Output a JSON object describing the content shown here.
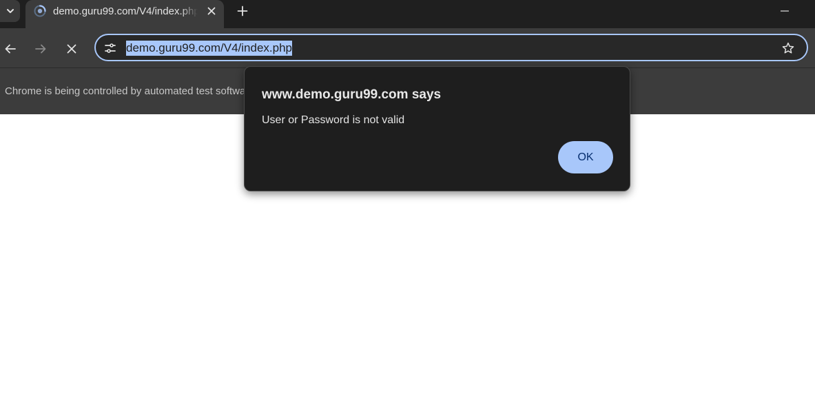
{
  "browser": {
    "tab": {
      "title": "demo.guru99.com/V4/index.php",
      "favicon": "loading-spinner-icon"
    },
    "controls": {
      "tab_search_icon": "chevron-down-icon",
      "close_tab_icon": "close-icon",
      "new_tab_icon": "plus-icon",
      "minimize_icon": "minimize-icon"
    },
    "toolbar": {
      "back_icon": "arrow-left-icon",
      "forward_icon": "arrow-right-icon",
      "stop_icon": "close-icon",
      "site_info_icon": "tune-icon",
      "bookmark_icon": "star-icon"
    },
    "address_bar": {
      "url": "demo.guru99.com/V4/index.php",
      "selected": true
    },
    "infobar": {
      "text": "Chrome is being controlled by automated test software."
    }
  },
  "dialog": {
    "title": "www.demo.guru99.com says",
    "message": "User or Password is not valid",
    "ok_label": "OK"
  },
  "colors": {
    "tabstrip_bg": "#1f1f1f",
    "toolbar_bg": "#3c3c3c",
    "omnibox_border": "#a8c7fa",
    "dialog_bg": "#1e1e1e",
    "ok_button_bg": "#a8c7fa",
    "page_bg": "#ffffff"
  }
}
